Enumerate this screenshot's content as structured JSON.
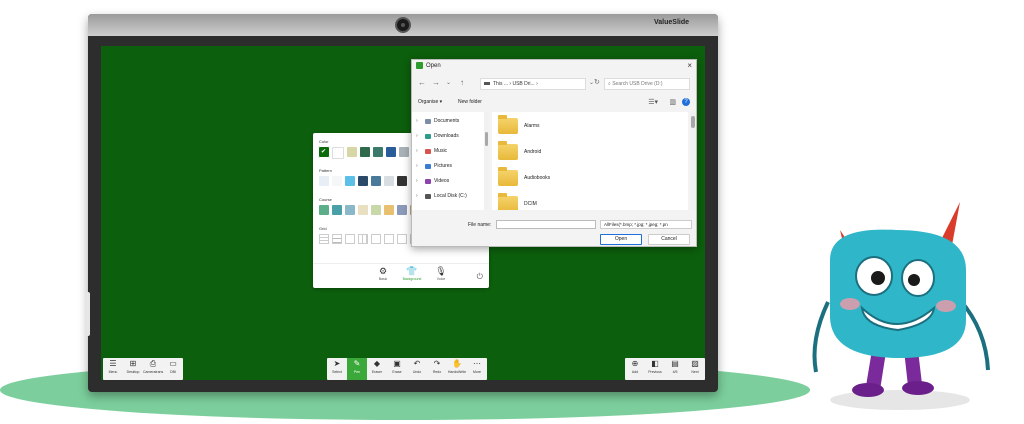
{
  "brand": "ValueSlide",
  "dialog": {
    "title": "Open",
    "address": [
      "This ...",
      "USB Dri..."
    ],
    "search_placeholder": "Search USB Drive (D:)",
    "commands": {
      "organise": "Organise",
      "new_folder": "New folder"
    },
    "nav_items": [
      {
        "label": "Documents",
        "color": "#7a8fa6"
      },
      {
        "label": "Downloads",
        "color": "#2e9b8e"
      },
      {
        "label": "Music",
        "color": "#d9534f"
      },
      {
        "label": "Pictures",
        "color": "#3a7bd5"
      },
      {
        "label": "Videos",
        "color": "#8e44ad"
      },
      {
        "label": "Local Disk (C:)",
        "color": "#555555"
      }
    ],
    "folders": [
      "Alarms",
      "Android",
      "Audiobooks",
      "DCIM"
    ],
    "file_name_label": "File name:",
    "file_name_value": "",
    "filter": "AllFiles(*.bmp; *.jpg; *.jpeg; *.pn",
    "open_label": "Open",
    "cancel_label": "Cancel"
  },
  "background_panel": {
    "sections": {
      "color": "Color",
      "pattern": "Pattern",
      "course": "Course",
      "grid": "Grid"
    },
    "colors": [
      "#0b6b0b",
      "#ffffff",
      "#d7d7a6",
      "#2f6a4b",
      "#3a7a6a",
      "#2b5c9a",
      "#a8b0b8",
      "#6aa86a"
    ],
    "patterns": [
      "#e8eef6",
      "#f4f6f8",
      "#5bc0e8",
      "#2b4a6a",
      "#4a7a9a",
      "#d8dde2",
      "#333333"
    ],
    "courses": [
      "#5aae8a",
      "#4aa0a8",
      "#8ab8c8",
      "#e8e0c0",
      "#c8d8a8",
      "#e8c070",
      "#8a9ab8",
      "#c8a878"
    ],
    "footer": [
      {
        "icon": "gear-icon",
        "label": "Basic"
      },
      {
        "icon": "shirt-icon",
        "label": "Background"
      },
      {
        "icon": "mic-icon",
        "label": "Voice"
      }
    ]
  },
  "toolbar": {
    "left": [
      {
        "icon": "list-icon",
        "label": "Menu"
      },
      {
        "icon": "windows-icon",
        "label": "Desktop"
      },
      {
        "icon": "camera-icon",
        "label": "Cameratrans"
      },
      {
        "icon": "screen-icon",
        "label": "DBI"
      }
    ],
    "center": [
      {
        "icon": "cursor-icon",
        "label": "Select",
        "active": false
      },
      {
        "icon": "pen-icon",
        "label": "Pen",
        "active": true
      },
      {
        "icon": "eraser-icon",
        "label": "Eraser",
        "active": false
      },
      {
        "icon": "erase-all-icon",
        "label": "Erase",
        "active": false
      },
      {
        "icon": "undo-icon",
        "label": "Undo",
        "active": false
      },
      {
        "icon": "redo-icon",
        "label": "Redo",
        "active": false
      },
      {
        "icon": "hand-icon",
        "label": "HandsWrite",
        "active": false
      },
      {
        "icon": "more-icon",
        "label": "More",
        "active": false
      }
    ],
    "right": [
      {
        "icon": "add-page-icon",
        "label": "Add"
      },
      {
        "icon": "previous-icon",
        "label": "Previous"
      },
      {
        "icon": "pages-icon",
        "label": "4/5"
      },
      {
        "icon": "next-icon",
        "label": "Next"
      }
    ]
  }
}
